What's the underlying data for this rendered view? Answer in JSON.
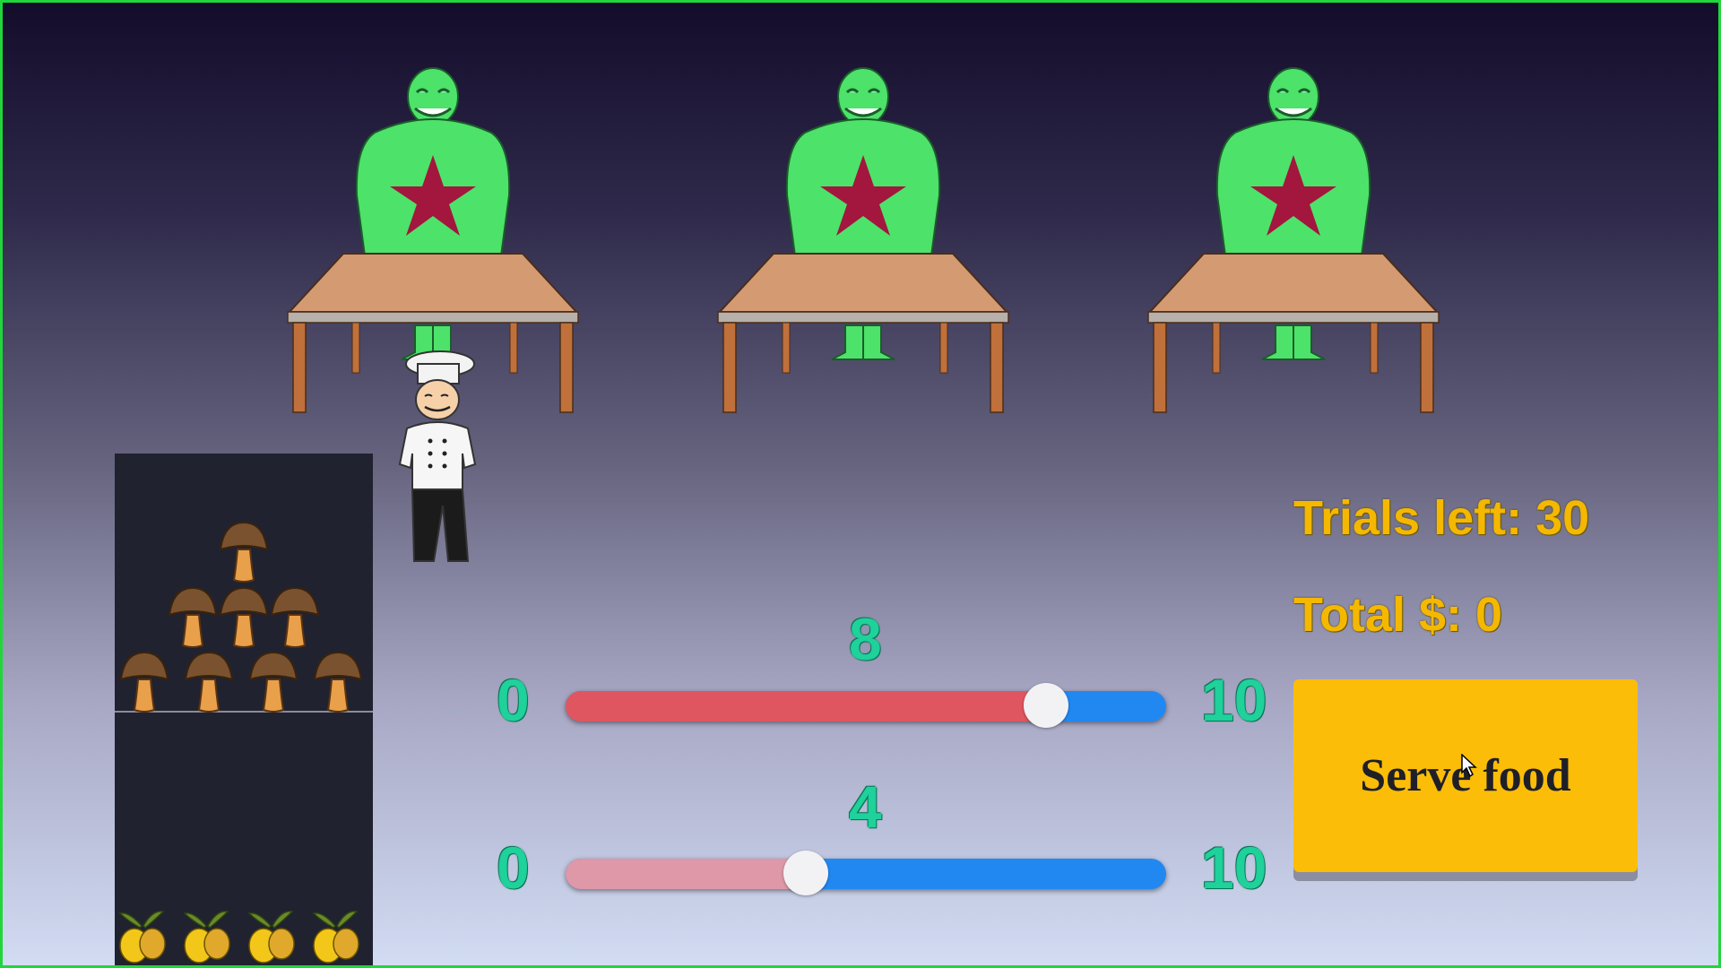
{
  "game": {
    "trials_label": "Trials left: 30",
    "total_label": "Total $: 0",
    "serve_button": "Serve food"
  },
  "sliders": [
    {
      "value_label": "8",
      "min_label": "0",
      "max_label": "10",
      "value": 8,
      "min": 0,
      "max": 10,
      "fill_color": "#e05660"
    },
    {
      "value_label": "4",
      "min_label": "0",
      "max_label": "10",
      "value": 4,
      "min": 0,
      "max": 10,
      "fill_color": "#de98a8"
    }
  ],
  "colors": {
    "monster_green": "#4de26a",
    "star": "#a3163e",
    "table_top": "#d49a72",
    "serve_button": "#fbbd08",
    "slider_track": "#2188f2",
    "number_teal": "#1fd19a",
    "status_gold": "#f5b800"
  },
  "icons": {
    "monster": "green-monster-icon",
    "table": "table-icon",
    "chef": "chef-icon",
    "mushroom": "mushroom-icon",
    "lemon": "lemon-icon",
    "cursor": "mouse-cursor-icon"
  }
}
